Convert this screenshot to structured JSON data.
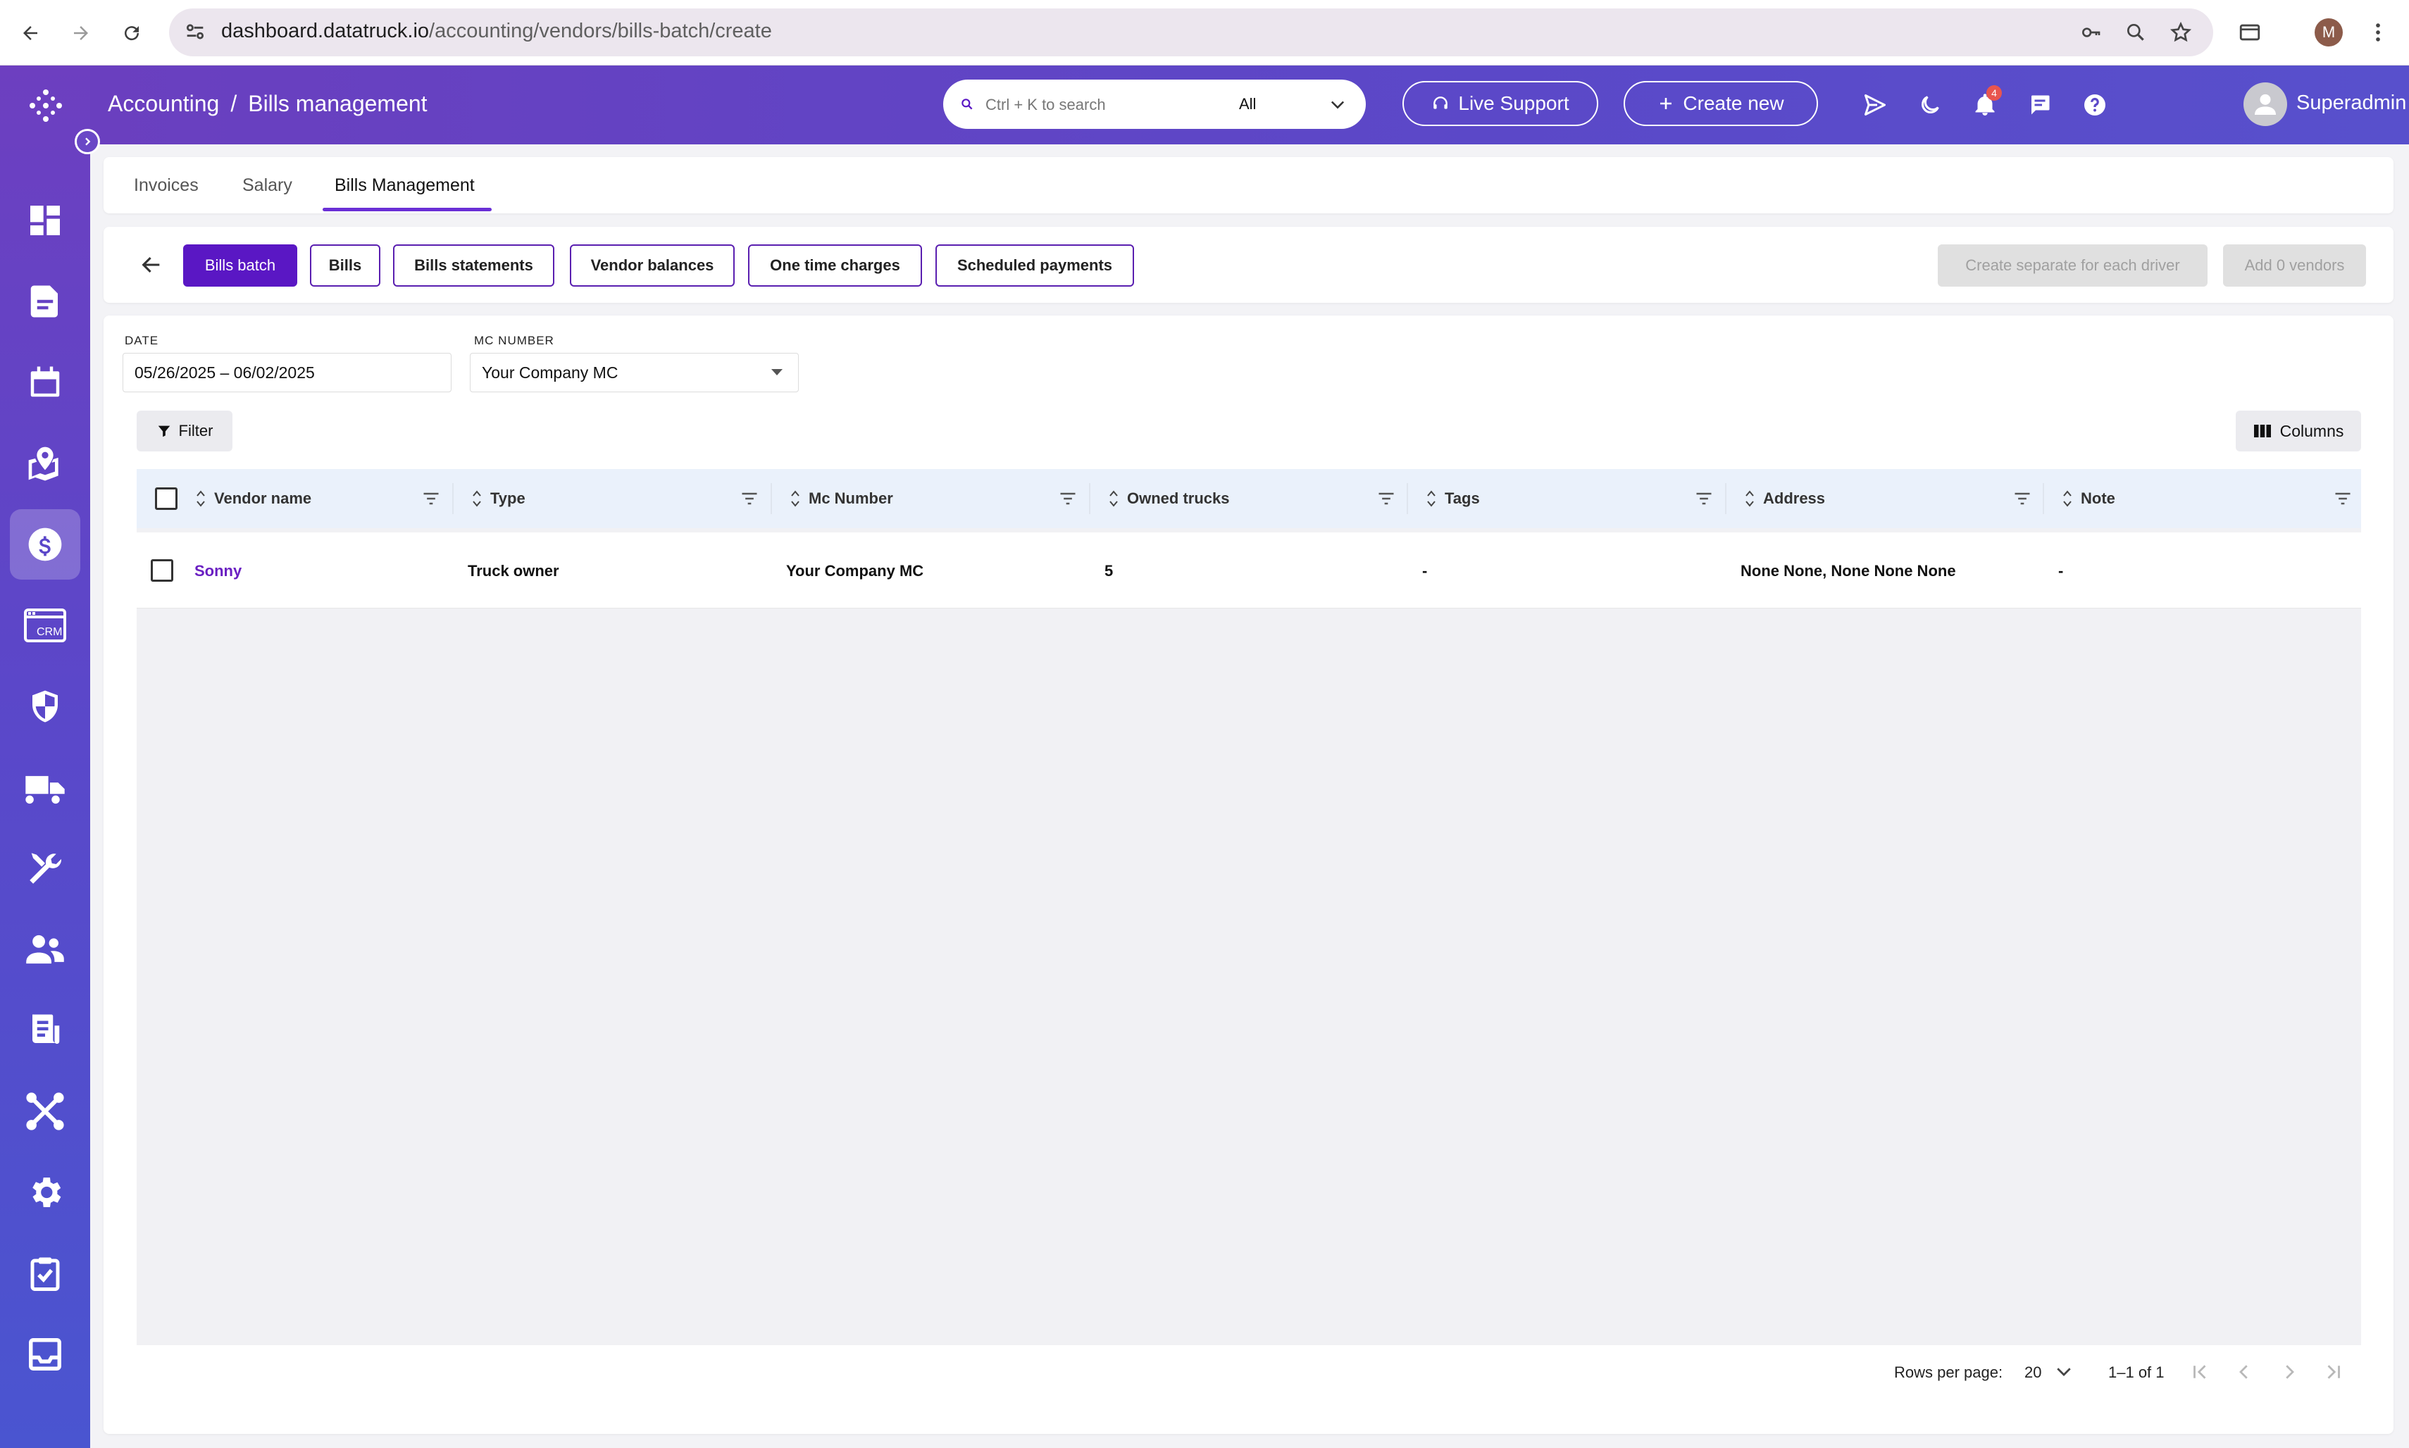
{
  "browser": {
    "url_domain": "dashboard.datatruck.io",
    "url_path": "/accounting/vendors/bills-batch/create",
    "profile_initial": "M"
  },
  "header": {
    "breadcrumb_root": "Accounting",
    "breadcrumb_sep": "/",
    "breadcrumb_current": "Bills management",
    "search_placeholder": "Ctrl + K to search",
    "search_scope": "All",
    "live_support": "Live Support",
    "create_new": "Create new",
    "notification_count": "4",
    "user_name": "Superadmin Super"
  },
  "tabs": {
    "invoices": "Invoices",
    "salary": "Salary",
    "bills_management": "Bills Management"
  },
  "subnav": {
    "bills_batch": "Bills batch",
    "bills": "Bills",
    "bills_statements": "Bills statements",
    "vendor_balances": "Vendor balances",
    "one_time_charges": "One time charges",
    "scheduled_payments": "Scheduled payments",
    "create_separate": "Create separate for each driver",
    "add_vendors": "Add 0 vendors"
  },
  "filters": {
    "date_label": "DATE",
    "date_value": "05/26/2025 – 06/02/2025",
    "mc_label": "MC NUMBER",
    "mc_value": "Your Company MC",
    "filter_button": "Filter",
    "columns_button": "Columns"
  },
  "table": {
    "columns": [
      "Vendor name",
      "Type",
      "Mc Number",
      "Owned trucks",
      "Tags",
      "Address",
      "Note"
    ],
    "rows": [
      {
        "vendor_name": "Sonny",
        "type": "Truck owner",
        "mc_number": "Your Company MC",
        "owned_trucks": "5",
        "tags": "-",
        "address": "None None, None None None",
        "note": "-"
      }
    ]
  },
  "pagination": {
    "rows_per_page_label": "Rows per page:",
    "rows_per_page": "20",
    "range": "1–1 of 1"
  },
  "colors": {
    "accent": "#5a17c4",
    "sidebar_top": "#6d3fc0",
    "sidebar_bottom": "#4a55d0",
    "link": "#6a1fc2"
  },
  "sidebar_icons": [
    "dashboard-icon",
    "document-icon",
    "calendar-icon",
    "map-icon",
    "dollar-icon",
    "crm-icon",
    "shield-icon",
    "truck-icon",
    "tools-icon",
    "users-icon",
    "report-icon",
    "integrations-icon",
    "settings-icon",
    "checklist-icon",
    "inbox-icon"
  ]
}
